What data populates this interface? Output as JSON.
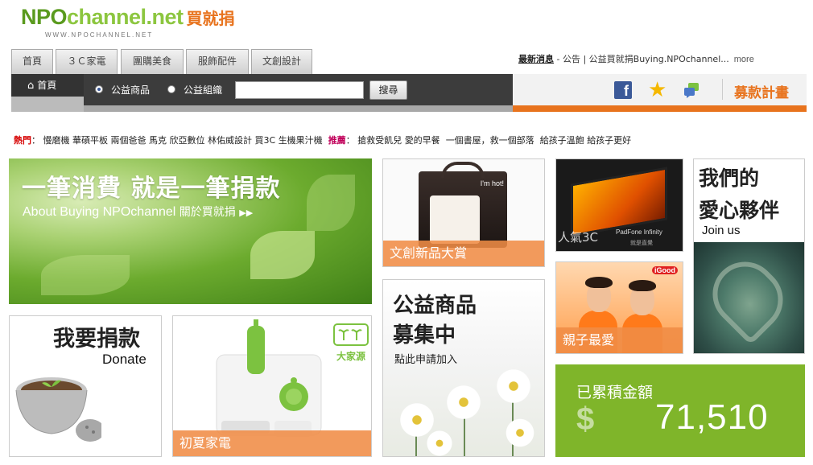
{
  "logo": {
    "brand_part1": "NPO",
    "brand_part2": "channel.net",
    "brand_cn": "買就捐",
    "url": "WWW.NPOCHANNEL.NET"
  },
  "tabs": [
    {
      "label": "首頁"
    },
    {
      "label": "３Ｃ家電"
    },
    {
      "label": "團購美食"
    },
    {
      "label": "服飾配件"
    },
    {
      "label": "文創設計"
    }
  ],
  "news": {
    "title": "最新消息",
    "dash": " - ",
    "text": "公告 | 公益買就捐Buying.NPOchannel...",
    "more": "more"
  },
  "nav": {
    "home_label": "首頁",
    "radio_options": [
      "公益商品",
      "公益組織"
    ],
    "radio_selected": 0,
    "search_value": "",
    "search_button": "搜尋"
  },
  "social": {
    "facebook_icon": "f",
    "donate_plan": "募款計畫"
  },
  "hot": {
    "hot_label": "熱門",
    "hot_sep": "：",
    "hot_items": [
      "慢磨機",
      "華碩平板",
      "兩個爸爸",
      "馬克",
      "欣亞數位",
      "林佑威設計",
      "買3C",
      "生機果汁機"
    ],
    "rec_label": "推薦",
    "rec_sep": "：",
    "rec_items": [
      "搶救受飢兒",
      "愛的早餐",
      "一個書屋，救一個部落",
      "給孩子溫飽",
      "給孩子更好"
    ]
  },
  "tiles": {
    "banner_title": "一筆消費 就是一筆捐款",
    "banner_sub_en": "About Buying NPOchannel",
    "banner_sub_cn": "關於買就捐",
    "banner_arrow": "▶▶",
    "creative_caption": "文創新品大賞",
    "creative_tag": "I'm hot!",
    "tv_caption": "人氣3C",
    "tv_brand": "PadFone Infinity",
    "tv_brand2": "就是直覺",
    "partners_title_1": "我們的",
    "partners_title_2": "愛心夥伴",
    "partners_join": "Join us",
    "parent_caption": "親子最愛",
    "parent_logo": "iGood",
    "charity_title_1": "公益商品",
    "charity_title_2": "募集中",
    "charity_sub": "點此申請加入",
    "donate_title": "我要捐款",
    "donate_en": "Donate",
    "summer_caption": "初夏家電",
    "summer_brand": "大家源",
    "total_label": "已累積金額",
    "total_currency": "$",
    "total_amount": "71,510"
  },
  "colors": {
    "accent_orange": "#e8731d",
    "brand_green": "#5a9a1e",
    "total_green": "#7fb52a"
  }
}
